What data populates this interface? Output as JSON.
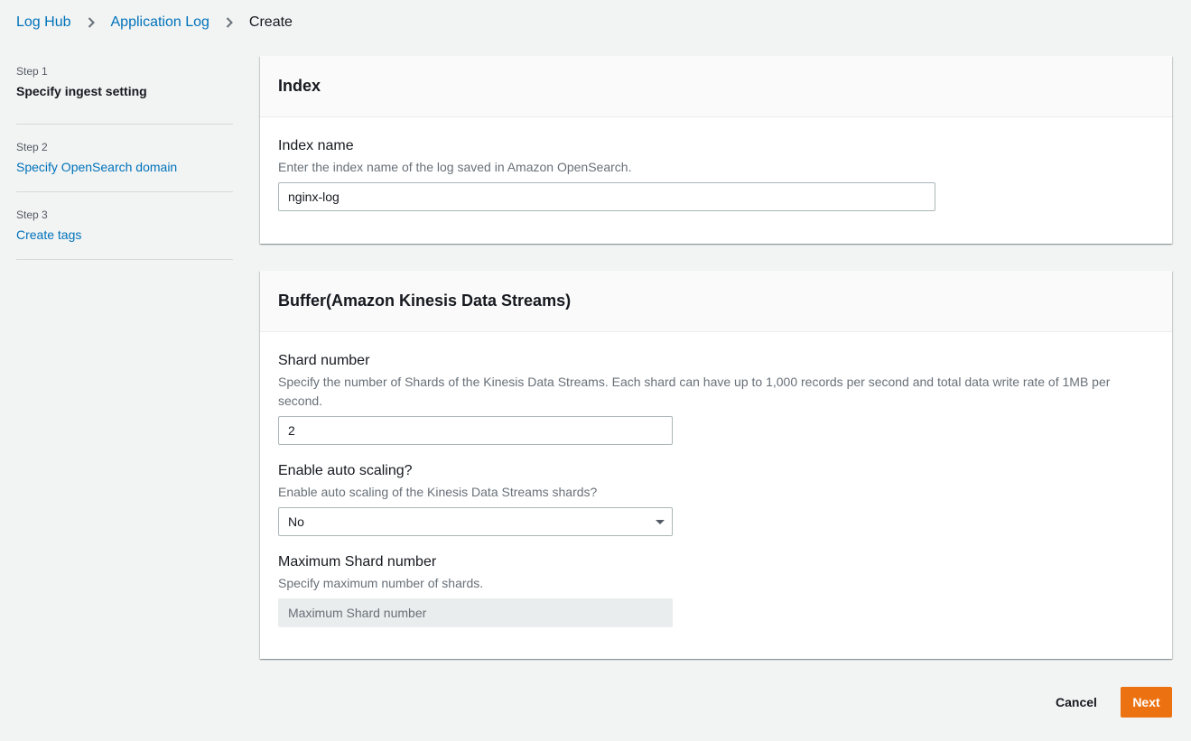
{
  "breadcrumb": {
    "items": [
      "Log Hub",
      "Application Log"
    ],
    "current": "Create"
  },
  "steps": [
    {
      "number": "Step 1",
      "title": "Specify ingest setting"
    },
    {
      "number": "Step 2",
      "title": "Specify OpenSearch domain"
    },
    {
      "number": "Step 3",
      "title": "Create tags"
    }
  ],
  "index_panel": {
    "title": "Index",
    "index_name": {
      "label": "Index name",
      "description": "Enter the index name of the log saved in Amazon OpenSearch.",
      "value": "nginx-log"
    }
  },
  "buffer_panel": {
    "title": "Buffer(Amazon Kinesis Data Streams)",
    "shard_number": {
      "label": "Shard number",
      "description": "Specify the number of Shards of the Kinesis Data Streams. Each shard can have up to 1,000 records per second and total data write rate of 1MB per second.",
      "value": "2"
    },
    "auto_scaling": {
      "label": "Enable auto scaling?",
      "description": "Enable auto scaling of the Kinesis Data Streams shards?",
      "selected": "No"
    },
    "max_shard": {
      "label": "Maximum Shard number",
      "description": "Specify maximum number of shards.",
      "placeholder": "Maximum Shard number",
      "value": ""
    }
  },
  "actions": {
    "cancel": "Cancel",
    "next": "Next"
  },
  "colors": {
    "link": "#0073bb",
    "primary_button": "#ec7211",
    "page_background": "#f2f3f3"
  }
}
